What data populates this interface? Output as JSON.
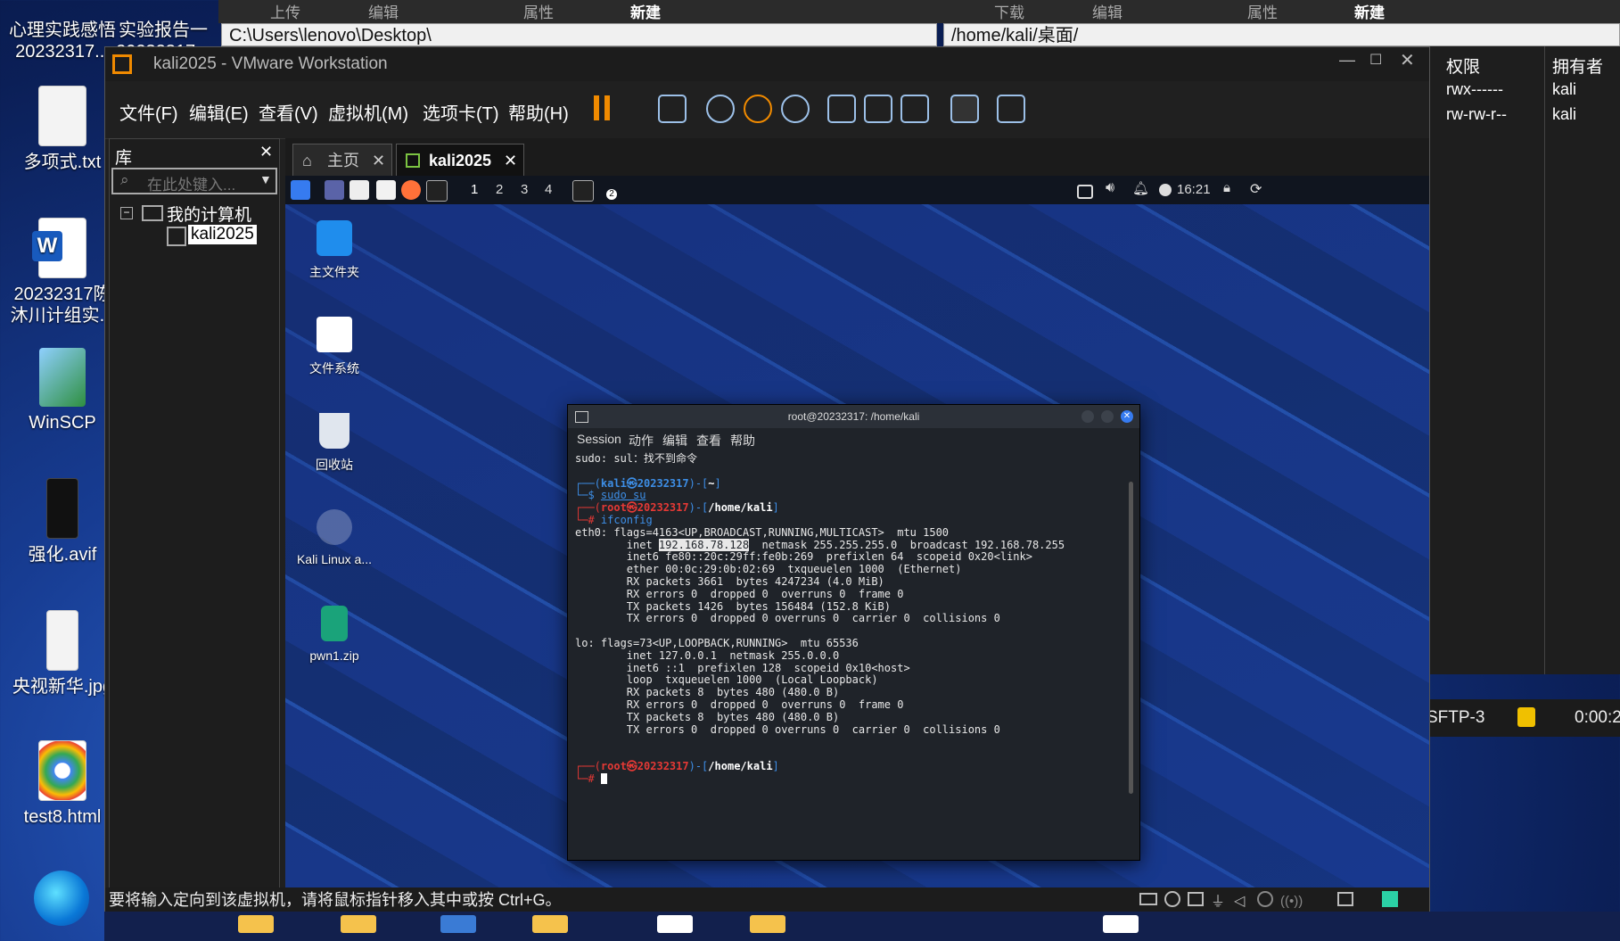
{
  "desktop": {
    "icons": [
      {
        "label": "心理实践感悟\n20232317..."
      },
      {
        "label": "实验报告一\n20232317..."
      },
      {
        "label": "多项式.txt"
      },
      {
        "label": "20232317陈\n沐川计组实..."
      },
      {
        "label": "WinSCP"
      },
      {
        "label": "强化.avif"
      },
      {
        "label": "央视新华.jpg"
      },
      {
        "label": "test8.html"
      }
    ]
  },
  "winscp": {
    "local_path": "C:\\Users\\lenovo\\Desktop\\",
    "remote_path": "/home/kali/桌面/",
    "toolbar_left": [
      "上传",
      "编辑",
      "属性",
      "新建"
    ],
    "toolbar_right": [
      "下载",
      "编辑",
      "属性",
      "新建"
    ],
    "columns": [
      "权限",
      "拥有者"
    ],
    "rows": [
      {
        "perm": "rwx------",
        "owner": "kali"
      },
      {
        "perm": "rw-rw-r--",
        "owner": "kali"
      }
    ],
    "session": "SFTP-3",
    "timer": "0:00:2"
  },
  "vmware": {
    "title": "kali2025 - VMware Workstation",
    "menu": [
      "文件(F)",
      "编辑(E)",
      "查看(V)",
      "虚拟机(M)",
      "选项卡(T)",
      "帮助(H)"
    ],
    "library_title": "库",
    "search_placeholder": "在此处键入...",
    "tree_root": "我的计算机",
    "tree_child": "kali2025",
    "tab_home": "主页",
    "tab_vm": "kali2025",
    "status": "要将输入定向到该虚拟机，请将鼠标指针移入其中或按 Ctrl+G。"
  },
  "guest": {
    "workspaces": [
      "1",
      "2",
      "3",
      "4"
    ],
    "clock": "16:21",
    "term_badge": "2",
    "icons": [
      {
        "label": "主文件夹"
      },
      {
        "label": "文件系统"
      },
      {
        "label": "回收站"
      },
      {
        "label": "Kali Linux a..."
      },
      {
        "label": "pwn1.zip"
      }
    ]
  },
  "terminal": {
    "title": "root@20232317: /home/kali",
    "menu": [
      "Session",
      "动作",
      "编辑",
      "查看",
      "帮助"
    ],
    "line_sudo_err": "sudo: sul：找不到命令",
    "prompt1_user": "kali㉿20232317",
    "prompt1_dir": "~",
    "cmd1": "sudo su",
    "prompt2_user": "root㉿20232317",
    "prompt2_dir": "/home/kali",
    "cmd2": "ifconfig",
    "eth0_l1": "eth0: flags=4163<UP,BROADCAST,RUNNING,MULTICAST>  mtu 1500",
    "eth0_inet_pre": "        inet ",
    "eth0_ip": "192.168.78.128",
    "eth0_inet_post": "  netmask 255.255.255.0  broadcast 192.168.78.255",
    "eth0_l3": "        inet6 fe80::20c:29ff:fe0b:269  prefixlen 64  scopeid 0x20<link>",
    "eth0_l4": "        ether 00:0c:29:0b:02:69  txqueuelen 1000  (Ethernet)",
    "eth0_l5": "        RX packets 3661  bytes 4247234 (4.0 MiB)",
    "eth0_l6": "        RX errors 0  dropped 0  overruns 0  frame 0",
    "eth0_l7": "        TX packets 1426  bytes 156484 (152.8 KiB)",
    "eth0_l8": "        TX errors 0  dropped 0 overruns 0  carrier 0  collisions 0",
    "lo_l1": "lo: flags=73<UP,LOOPBACK,RUNNING>  mtu 65536",
    "lo_l2": "        inet 127.0.0.1  netmask 255.0.0.0",
    "lo_l3": "        inet6 ::1  prefixlen 128  scopeid 0x10<host>",
    "lo_l4": "        loop  txqueuelen 1000  (Local Loopback)",
    "lo_l5": "        RX packets 8  bytes 480 (480.0 B)",
    "lo_l6": "        RX errors 0  dropped 0  overruns 0  frame 0",
    "lo_l7": "        TX packets 8  bytes 480 (480.0 B)",
    "lo_l8": "        TX errors 0  dropped 0 overruns 0  carrier 0  collisions 0",
    "prompt3_user": "root㉿20232317",
    "prompt3_dir": "/home/kali"
  }
}
